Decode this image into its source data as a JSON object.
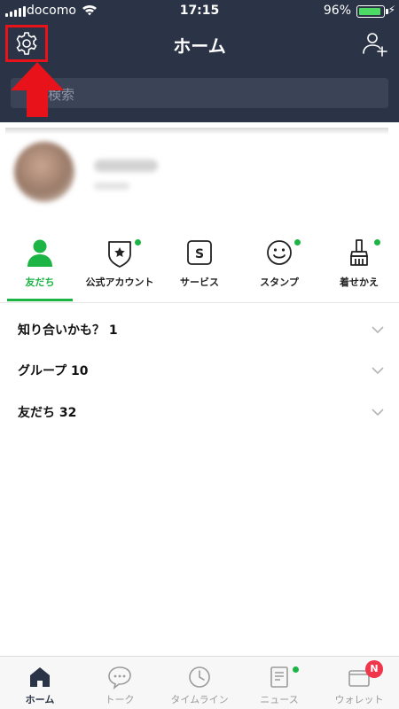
{
  "status_bar": {
    "carrier": "docomo",
    "time": "17:15",
    "battery": "96%",
    "battery_level": 0.96
  },
  "header": {
    "title": "ホーム",
    "settings_icon": "gear-icon",
    "add_friend_icon": "add-friend-icon"
  },
  "search": {
    "placeholder": "検索"
  },
  "tabs": [
    {
      "label": "友だち",
      "icon": "friends-icon",
      "active": true
    },
    {
      "label": "公式アカウント",
      "icon": "official-account-icon",
      "dot": true
    },
    {
      "label": "サービス",
      "icon": "service-icon",
      "glyph": "S"
    },
    {
      "label": "スタンプ",
      "icon": "stamp-icon",
      "dot": true
    },
    {
      "label": "着せかえ",
      "icon": "theme-icon",
      "dot": true
    }
  ],
  "sections": [
    {
      "title": "知り合いかも？ 1"
    },
    {
      "title": "グループ 10"
    },
    {
      "title": "友だち 32"
    }
  ],
  "bottom_nav": [
    {
      "label": "ホーム",
      "icon": "home-icon",
      "active": true
    },
    {
      "label": "トーク",
      "icon": "chat-icon"
    },
    {
      "label": "タイムライン",
      "icon": "timeline-icon"
    },
    {
      "label": "ニュース",
      "icon": "news-icon",
      "dot": true
    },
    {
      "label": "ウォレット",
      "icon": "wallet-icon",
      "badge": "N"
    }
  ],
  "colors": {
    "header_bg": "#2b3446",
    "accent_green": "#1db446",
    "highlight_red": "#e8121a",
    "badge_red": "#f0364a"
  }
}
